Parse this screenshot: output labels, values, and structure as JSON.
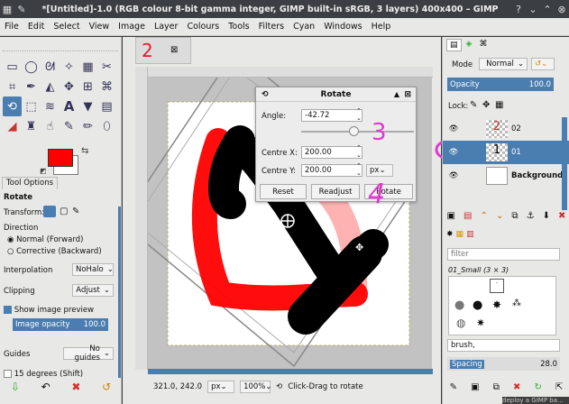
{
  "window": {
    "title": "*[Untitled]-1.0 (RGB colour 8-bit gamma integer, GIMP built-in sRGB, 3 layers) 400x400 – GIMP",
    "pin": "✎"
  },
  "menu": [
    "File",
    "Edit",
    "Select",
    "View",
    "Image",
    "Layer",
    "Colours",
    "Tools",
    "Filters",
    "Cyan",
    "Windows",
    "Help"
  ],
  "toolbox": {
    "tools": [
      "rect-select",
      "ellipse-select",
      "lasso",
      "fuzzy-select",
      "by-color-select",
      "scissors",
      "crop",
      "eyedropper",
      "unified-transform",
      "move",
      "align",
      "rotate",
      "scale",
      "shear",
      "text",
      "bucket-fill",
      "flip",
      "perspective",
      "paintbrush",
      "clone",
      "smudge",
      "dodge",
      "heal",
      "path"
    ]
  },
  "colors": {
    "fg": "#ff0000",
    "bg": "#ffffff",
    "accent": "#4a7db0"
  },
  "tool_options": {
    "tab": "Tool Options",
    "title": "Rotate",
    "transform_label": "Transform:",
    "direction_label": "Direction",
    "direction_normal": "Normal (Forward)",
    "direction_corrective": "Corrective (Backward)",
    "interpolation_label": "Interpolation",
    "interpolation_value": "NoHalo",
    "clipping_label": "Clipping",
    "clipping_value": "Adjust",
    "preview_label": "Show image preview",
    "opacity_label": "Image opacity",
    "opacity_value": "100.0",
    "guides_label": "Guides",
    "guides_value": "No guides",
    "fifteen_label": "15 degrees (Shift)"
  },
  "image_tab": {
    "number": "2"
  },
  "status": {
    "coords": "321.0, 242.0",
    "unit": "px",
    "zoom": "100%",
    "hint": "Click-Drag to rotate"
  },
  "rotate_dialog": {
    "title": "Rotate",
    "angle_label": "Angle:",
    "angle_value": "-42.72",
    "angle_fraction": 0.46,
    "cx_label": "Centre X:",
    "cx_value": "200.00",
    "cy_label": "Centre Y:",
    "cy_value": "200.00",
    "unit": "px",
    "reset": "Reset",
    "readjust": "Readjust",
    "rotate": "Rotate"
  },
  "annotations": {
    "three": "3",
    "four": "4"
  },
  "layers_panel": {
    "mode_label": "Mode",
    "mode_value": "Normal",
    "opacity_label": "Opacity",
    "opacity_value": "100.0",
    "lock_label": "Lock:",
    "layers": [
      {
        "name": "02",
        "selected": false
      },
      {
        "name": "01",
        "selected": true
      },
      {
        "name": "Background",
        "selected": false
      }
    ]
  },
  "brushes_panel": {
    "filter_placeholder": "filter",
    "brush_name": "01_Small (3 × 3)",
    "tag_value": "brush,",
    "spacing_label": "Spacing",
    "spacing_value": "28.0"
  },
  "taskbar_hint": "deploy a GIMP ba..."
}
